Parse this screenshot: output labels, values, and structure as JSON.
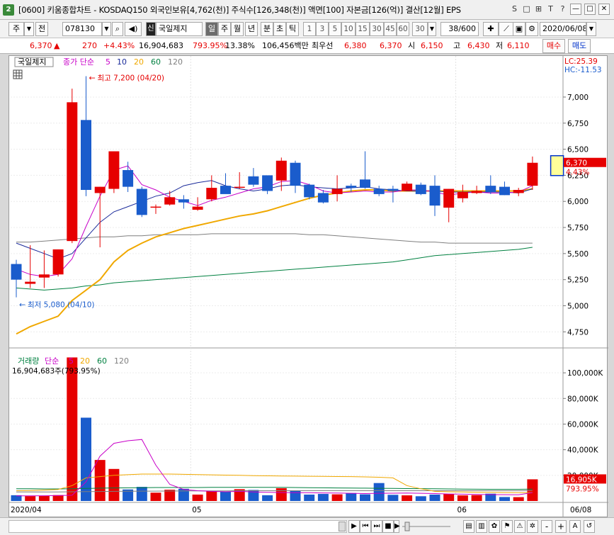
{
  "window": {
    "badge": "2",
    "title": "[0600] 키움종합차트 - KOSDAQ150 외국인보유[4,762(천)] 주식수[126,348(천)] 액면[100] 자본금[126(억)] 결산[12월] EPS",
    "icons": [
      "S",
      "□",
      "⊞",
      "T",
      "?"
    ],
    "controls": [
      "—",
      "□",
      "✕"
    ]
  },
  "toolbar": {
    "period_select": "주",
    "prev_label": "전",
    "code_value": "078130",
    "stock_badge": "신",
    "stock_name": "국일제지",
    "periods": [
      "일",
      "주",
      "월",
      "년",
      "분",
      "초",
      "틱"
    ],
    "active_period": "일",
    "minute_options": [
      "1",
      "3",
      "5",
      "10",
      "15",
      "30",
      "45",
      "60"
    ],
    "count_select": "30",
    "count_display": "38/600",
    "date_value": "2020/06/08"
  },
  "quote": {
    "price": "6,370",
    "change_arrow": "▲",
    "change": "270",
    "change_rate": "+4.43%",
    "volume": "16,904,683",
    "volume_rate": "793.95%",
    "turnover": "13.38%",
    "amount": "106,456백만",
    "best_label": "최우선",
    "best_bid": "6,380",
    "best_ask": "6,370",
    "open_label": "시",
    "open": "6,150",
    "high_label": "고",
    "high": "6,430",
    "low_label": "저",
    "low": "6,110",
    "buy_label": "매수",
    "sell_label": "매도"
  },
  "price_panel": {
    "name_box": "국일제지",
    "legend_name": "종가 단순",
    "legend_periods": [
      "5",
      "10",
      "20",
      "60",
      "120"
    ],
    "high_note": "최고 7,200 (04/20)",
    "low_note": "최저 5,080 (04/10)",
    "lc_label": "LC:25.39",
    "hc_label": "HC:-11.53",
    "current_price_tag": "6,370",
    "current_rate_tag": "4.43%",
    "y_ticks": [
      "7,000",
      "6,750",
      "6,500",
      "6,250",
      "6,000",
      "5,750",
      "5,500",
      "5,250",
      "5,000",
      "4,750"
    ]
  },
  "volume_panel": {
    "legend_name": "거래량",
    "legend_ma": "단순",
    "legend_periods": [
      "5",
      "20",
      "60",
      "120"
    ],
    "current_text": "16,904,683주(793.95%)",
    "current_tag": "16,905K",
    "current_rate_tag": "793.95%",
    "y_ticks": [
      "100,000K",
      "80,000K",
      "60,000K",
      "40,000K",
      "20,000K"
    ]
  },
  "x_axis": {
    "labels": [
      {
        "text": "2020/04",
        "index": 0
      },
      {
        "text": "05",
        "index": 13
      },
      {
        "text": "06",
        "index": 32
      }
    ],
    "right_label": "06/08"
  },
  "footer": {
    "buttons": [
      "▶",
      "⏮",
      "⏭",
      "■",
      "▶"
    ],
    "zoom": [
      "-",
      "+",
      "A"
    ]
  },
  "colors": {
    "up": "#e60000",
    "down": "#1a5ccc",
    "ma5": "#c800c8",
    "ma10": "#1a2a9a",
    "ma20": "#f0a800",
    "ma60": "#008040",
    "ma120": "#7f7f7f"
  },
  "chart_data": {
    "type": "candlestick",
    "ohlc_columns": [
      "open",
      "high",
      "low",
      "close"
    ],
    "candles": [
      [
        5400,
        5440,
        5080,
        5250
      ],
      [
        5210,
        5580,
        5170,
        5230
      ],
      [
        5270,
        5530,
        5170,
        5300
      ],
      [
        5300,
        5540,
        5280,
        5540
      ],
      [
        5620,
        7080,
        5600,
        6950
      ],
      [
        6780,
        7200,
        6050,
        6110
      ],
      [
        6080,
        6140,
        5560,
        6140
      ],
      [
        6120,
        6480,
        6080,
        6480
      ],
      [
        6300,
        6380,
        6090,
        6140
      ],
      [
        6120,
        6140,
        5850,
        5870
      ],
      [
        5940,
        5970,
        5880,
        5950
      ],
      [
        5970,
        6100,
        5960,
        6040
      ],
      [
        6020,
        6060,
        5930,
        5990
      ],
      [
        5920,
        6040,
        5910,
        5950
      ],
      [
        6020,
        6250,
        6000,
        6130
      ],
      [
        6150,
        6270,
        6080,
        6070
      ],
      [
        6140,
        6280,
        6120,
        6140
      ],
      [
        6240,
        6320,
        6140,
        6160
      ],
      [
        6250,
        6230,
        6070,
        6100
      ],
      [
        6200,
        6420,
        6100,
        6390
      ],
      [
        6370,
        6390,
        6080,
        6150
      ],
      [
        6160,
        6170,
        6020,
        6040
      ],
      [
        6080,
        6110,
        5980,
        5990
      ],
      [
        6070,
        6250,
        6000,
        6120
      ],
      [
        6150,
        6170,
        6090,
        6130
      ],
      [
        6210,
        6480,
        6120,
        6130
      ],
      [
        6120,
        6150,
        6050,
        6070
      ],
      [
        6120,
        6150,
        5990,
        6100
      ],
      [
        6100,
        6190,
        6100,
        6170
      ],
      [
        6160,
        6180,
        6060,
        6070
      ],
      [
        6150,
        6250,
        5860,
        5960
      ],
      [
        5940,
        6120,
        5800,
        6120
      ],
      [
        6030,
        6160,
        5990,
        6090
      ],
      [
        6080,
        6150,
        6070,
        6100
      ],
      [
        6150,
        6250,
        6070,
        6090
      ],
      [
        6140,
        6190,
        6060,
        6060
      ],
      [
        6080,
        6130,
        6050,
        6110
      ],
      [
        6150,
        6430,
        6110,
        6370
      ]
    ],
    "volume_k": [
      4500,
      3800,
      3900,
      4600,
      112000,
      65000,
      32000,
      25000,
      9000,
      11000,
      6500,
      8800,
      9500,
      5000,
      8000,
      7200,
      9200,
      8600,
      4500,
      10000,
      8200,
      5000,
      5500,
      5200,
      6200,
      5200,
      14000,
      4800,
      4400,
      3700,
      5000,
      5500,
      4400,
      4600,
      5700,
      3100,
      3000,
      16905
    ],
    "ma_volume_5": [
      4000,
      4000,
      4100,
      4200,
      4500,
      15000,
      35000,
      45000,
      47000,
      48000,
      28000,
      13000,
      9000,
      8000,
      7500,
      7200,
      7500,
      7000,
      6800,
      6600,
      6500,
      6400,
      6300,
      6200,
      6000,
      5800,
      6000,
      6100,
      6200,
      6000,
      5800,
      5500,
      5300,
      5100,
      5000,
      4900,
      4800,
      6500
    ],
    "ma_volume_20": [
      8000,
      8200,
      8500,
      9000,
      12000,
      18000,
      19000,
      20000,
      20500,
      21000,
      21000,
      21000,
      20800,
      20600,
      20400,
      20200,
      20000,
      19800,
      19600,
      19500,
      19400,
      19300,
      19200,
      19100,
      19000,
      18800,
      18500,
      18000,
      12000,
      9500,
      7500,
      7200,
      7000,
      6800,
      6700,
      6600,
      6500,
      6500
    ],
    "ma_volume_60": [
      9500,
      9500,
      9400,
      9400,
      9500,
      9800,
      10000,
      10200,
      10300,
      10400,
      10500,
      10500,
      10500,
      10500,
      10600,
      10600,
      10600,
      10600,
      10600,
      10600,
      10500,
      10400,
      10300,
      10200,
      10100,
      10000,
      9900,
      9800,
      9700,
      9600,
      9500,
      9400,
      9300,
      9200,
      9100,
      9100,
      9100,
      9300
    ],
    "ma_volume_120": [
      7000,
      7000,
      7100,
      7100,
      7200,
      7300,
      7400,
      7500,
      7600,
      7700,
      7700,
      7800,
      7800,
      7900,
      7900,
      7900,
      8000,
      8000,
      8000,
      8000,
      8000,
      8000,
      8000,
      8000,
      8000,
      8000,
      8000,
      8000,
      8000,
      8000,
      8000,
      8000,
      8000,
      8000,
      8000,
      8000,
      8000,
      8100
    ],
    "ma5": [
      5350,
      5300,
      5280,
      5300,
      5450,
      5760,
      6050,
      6300,
      6340,
      6160,
      6110,
      6040,
      6000,
      5960,
      6010,
      6040,
      6080,
      6120,
      6140,
      6190,
      6200,
      6160,
      6100,
      6080,
      6090,
      6100,
      6090,
      6090,
      6110,
      6110,
      6090,
      6060,
      6080,
      6090,
      6080,
      6080,
      6090,
      6150
    ],
    "ma10": [
      5600,
      5550,
      5500,
      5450,
      5500,
      5650,
      5800,
      5900,
      5950,
      6000,
      6050,
      6080,
      6150,
      6180,
      6200,
      6150,
      6120,
      6100,
      6120,
      6150,
      6160,
      6140,
      6130,
      6120,
      6130,
      6140,
      6120,
      6110,
      6100,
      6100,
      6100,
      6090,
      6090,
      6090,
      6090,
      6090,
      6080,
      6120
    ],
    "ma20": [
      4730,
      4800,
      4850,
      4900,
      5050,
      5150,
      5250,
      5420,
      5530,
      5600,
      5660,
      5700,
      5740,
      5770,
      5800,
      5830,
      5860,
      5880,
      5910,
      5950,
      5990,
      6030,
      6060,
      6080,
      6100,
      6110,
      6110,
      6100,
      6100,
      6100,
      6100,
      6100,
      6100,
      6100,
      6100,
      6100,
      6100,
      6120
    ],
    "ma60": [
      5170,
      5160,
      5150,
      5160,
      5170,
      5190,
      5200,
      5220,
      5230,
      5240,
      5250,
      5260,
      5270,
      5280,
      5290,
      5300,
      5310,
      5320,
      5330,
      5340,
      5350,
      5360,
      5370,
      5380,
      5390,
      5400,
      5410,
      5420,
      5440,
      5460,
      5480,
      5490,
      5500,
      5510,
      5520,
      5530,
      5540,
      5560
    ],
    "ma120": [
      5610,
      5610,
      5620,
      5630,
      5640,
      5650,
      5660,
      5660,
      5670,
      5670,
      5680,
      5680,
      5680,
      5680,
      5690,
      5690,
      5690,
      5690,
      5690,
      5690,
      5690,
      5680,
      5680,
      5670,
      5660,
      5650,
      5640,
      5630,
      5620,
      5610,
      5610,
      5600,
      5600,
      5600,
      5600,
      5600,
      5600,
      5600
    ],
    "price_ylim": [
      4650,
      7380
    ],
    "volume_ylim": [
      0,
      115000
    ],
    "yaxis_side": "right",
    "grid": true
  }
}
